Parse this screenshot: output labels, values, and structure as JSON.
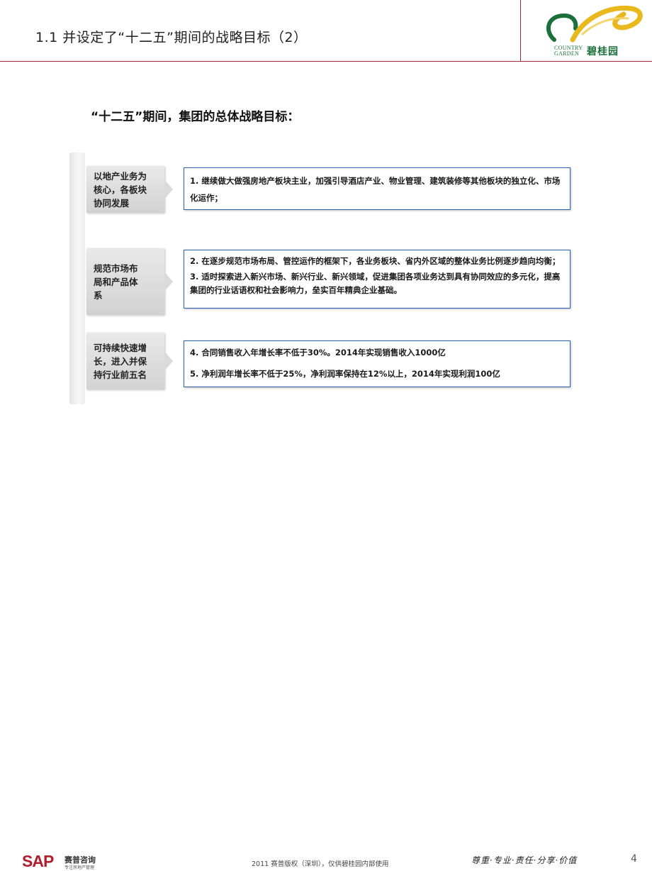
{
  "header": {
    "title": "1.1   并设定了“十二五”期间的战略目标（2）",
    "logo": {
      "text": "碧桂园",
      "sub_lines": [
        "COUNTRY",
        "GARDEN"
      ]
    }
  },
  "main": {
    "heading": "“十二五”期间，集团的总体战略目标：",
    "rows": [
      {
        "category": "以地产业务为核心，各板块协同发展",
        "goals": [
          "1. 继续做大做强房地产板块主业，加强引导酒店产业、物业管理、建筑装修等其他板块的独立化、市场化运作；"
        ]
      },
      {
        "category": "规范市场布局和产品体系",
        "goals": [
          "2. 在逐步规范市场布局、管控运作的框架下，各业务板块、省内外区域的整体业务比例逐步趋向均衡；",
          "3. 适时探索进入新兴市场、新兴行业、新兴领域，促进集团各项业务达到具有协同效应的多元化，提高集团的行业话语权和社会影响力，垒实百年精典企业基础。"
        ]
      },
      {
        "category": "可持续快速增长，进入并保持行业前五名",
        "goals": [
          "4. 合同销售收入年增长率不低于30%。2014年实现销售收入1000亿",
          "5. 净利润年增长率不低于25%，净利润率保持在12%以上，2014年实现利润100亿"
        ]
      }
    ]
  },
  "footer": {
    "sap_logo": "SAP",
    "sap_cn": "赛普咨询",
    "sap_cn_sub": "专注房地产管理",
    "copyright": "2011 赛普版权（深圳），仅供碧桂园内部使用",
    "motto": "尊重·专业·责任·分享·价值",
    "page_number": "4"
  },
  "colors": {
    "accent_rule": "#9a2a3a",
    "box_border": "#2b63b4",
    "logo_green": "#1b6f3a",
    "logo_gold": "#e8b81c",
    "sap_red": "#b01f2e"
  }
}
